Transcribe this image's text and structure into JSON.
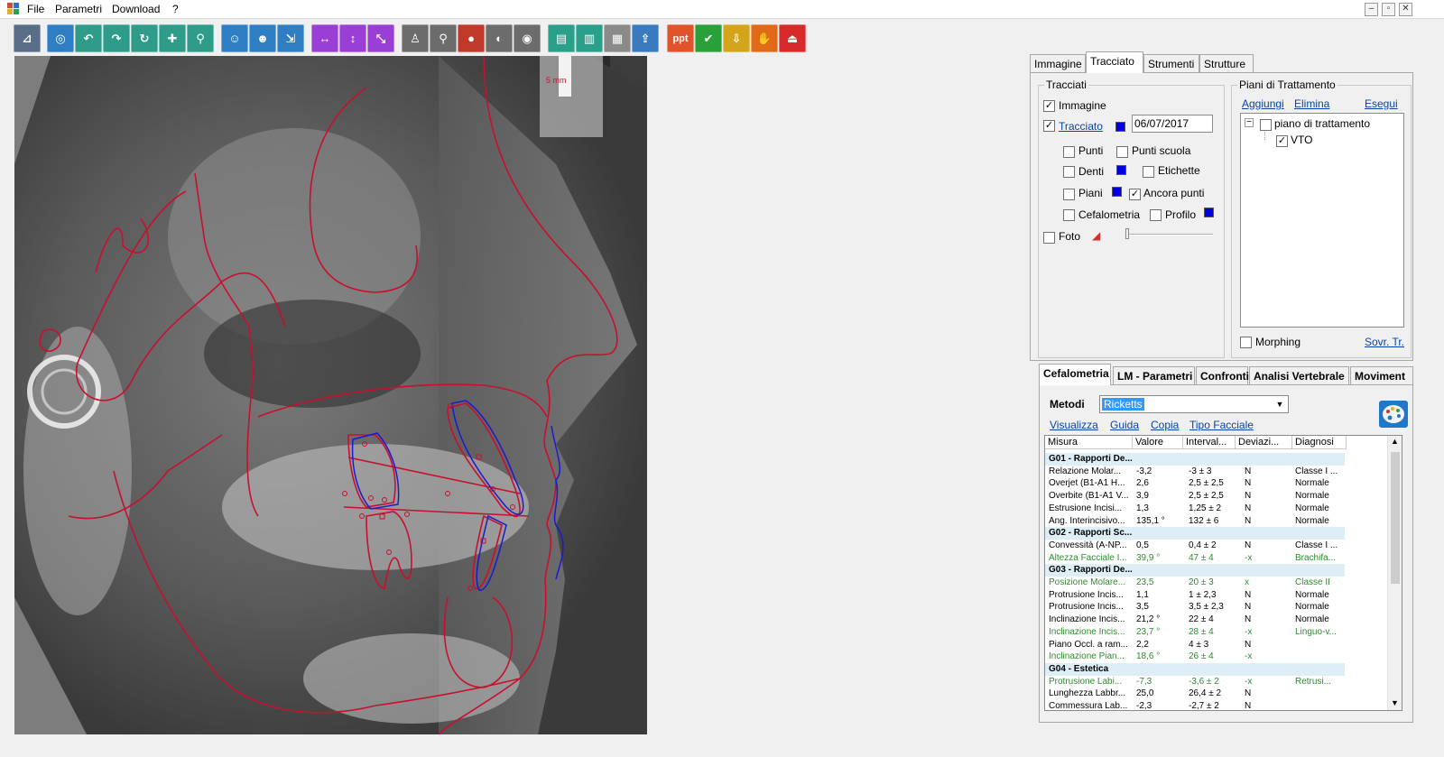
{
  "menu": {
    "items": [
      "File",
      "Parametri",
      "Download",
      "?"
    ]
  },
  "window_controls": [
    "–",
    "▫",
    "✕"
  ],
  "toolbar": {
    "buttons": [
      {
        "name": "measure-tool-icon",
        "color": "#5a6e87"
      },
      {
        "name": "point-zoom-icon",
        "color": "#2f7ec4"
      },
      {
        "name": "undo-icon",
        "color": "#2f9c8a"
      },
      {
        "name": "redo-icon",
        "color": "#2f9c8a"
      },
      {
        "name": "rotate-point-icon",
        "color": "#2f9c8a"
      },
      {
        "name": "point-add-icon",
        "color": "#2f9c8a"
      },
      {
        "name": "point-search-icon",
        "color": "#2f9c8a"
      },
      {
        "name": "patient-photo-icon",
        "color": "#2f7ec4"
      },
      {
        "name": "patient-search-icon",
        "color": "#2f7ec4"
      },
      {
        "name": "profile-import-icon",
        "color": "#2f7ec4"
      },
      {
        "name": "move-horizontal-icon",
        "color": "#9a3fd6"
      },
      {
        "name": "move-vertical-icon",
        "color": "#9a3fd6"
      },
      {
        "name": "move-diagonal-icon",
        "color": "#9a3fd6"
      },
      {
        "name": "person-profile-icon",
        "color": "#6c6c6c"
      },
      {
        "name": "magnifier-icon",
        "color": "#6c6c6c"
      },
      {
        "name": "lips-icon",
        "color": "#c0392b"
      },
      {
        "name": "face-contour-icon",
        "color": "#6c6c6c"
      },
      {
        "name": "eye-icon",
        "color": "#6c6c6c"
      },
      {
        "name": "print-icon",
        "color": "#2aa08a"
      },
      {
        "name": "print-preview-icon",
        "color": "#2aa08a"
      },
      {
        "name": "print-report-icon",
        "color": "#8a8a8a"
      },
      {
        "name": "export-icon",
        "color": "#3a7bbf"
      },
      {
        "name": "powerpoint-icon",
        "color": "#e0532b",
        "text": "ppt"
      },
      {
        "name": "check-icon",
        "color": "#2aa03a"
      },
      {
        "name": "download-icon",
        "color": "#d4a51a"
      },
      {
        "name": "hand-icon",
        "color": "#e06a18"
      },
      {
        "name": "exit-icon",
        "color": "#d82a2a"
      }
    ]
  },
  "xray": {
    "ruler_label": "5 mm"
  },
  "top_tabs": [
    {
      "label": "Immagine",
      "active": false
    },
    {
      "label": "Tracciato",
      "active": true
    },
    {
      "label": "Strumenti",
      "active": false
    },
    {
      "label": "Strutture",
      "active": false
    }
  ],
  "tracciati": {
    "legend": "Tracciati",
    "immagine_label": "Immagine",
    "immagine_checked": true,
    "tracciato_label": "Tracciato",
    "tracciato_checked": true,
    "tracciato_color": "#0000e0",
    "date_value": "06/07/2017",
    "punti_label": "Punti",
    "punti_scuola_label": "Punti scuola",
    "denti_label": "Denti",
    "etichette_label": "Etichette",
    "piani_label": "Piani",
    "ancora_punti_label": "Ancora punti",
    "ancora_punti_checked": true,
    "cefalometria_label": "Cefalometria",
    "profilo_label": "Profilo",
    "foto_label": "Foto"
  },
  "piani": {
    "legend": "Piani di Trattamento",
    "aggiungi": "Aggiungi",
    "elimina": "Elimina",
    "esegui": "Esegui",
    "tree_root": "piano di trattamento",
    "tree_child": "VTO",
    "tree_child_checked": true,
    "morphing_label": "Morphing",
    "sovr_tr": "Sovr. Tr."
  },
  "bottom_tabs": [
    {
      "label": "Cefalometria",
      "active": true
    },
    {
      "label": "LM - Parametri",
      "active": false
    },
    {
      "label": "Confronti",
      "active": false
    },
    {
      "label": "Analisi Vertebrale",
      "active": false
    },
    {
      "label": "Moviment",
      "active": false
    }
  ],
  "cefalometria": {
    "metodi_label": "Metodi",
    "metodi_value": "Ricketts",
    "links": [
      "Visualizza",
      "Guida",
      "Copia",
      "Tipo Facciale"
    ],
    "columns": [
      "Misura",
      "Valore",
      "Interval...",
      "Deviazi...",
      "Diagnosi"
    ],
    "rows": [
      {
        "group": true,
        "misura": "G01 - Rapporti De..."
      },
      {
        "misura": "Relazione Molar...",
        "valore": "-3,2",
        "intervallo": "-3 ± 3",
        "deviazione": "N",
        "diagnosi": "Classe I ...",
        "highlight": false
      },
      {
        "misura": "Overjet (B1-A1 H...",
        "valore": "2,6",
        "intervallo": "2,5 ± 2,5",
        "deviazione": "N",
        "diagnosi": "Normale",
        "highlight": false
      },
      {
        "misura": "Overbite (B1-A1 V...",
        "valore": "3,9",
        "intervallo": "2,5 ± 2,5",
        "deviazione": "N",
        "diagnosi": "Normale",
        "highlight": false
      },
      {
        "misura": "Estrusione Incisi...",
        "valore": "1,3",
        "intervallo": "1,25 ± 2",
        "deviazione": "N",
        "diagnosi": "Normale",
        "highlight": false
      },
      {
        "misura": "Ang. Interincisivo...",
        "valore": "135,1 °",
        "intervallo": "132 ± 6",
        "deviazione": "N",
        "diagnosi": "Normale",
        "highlight": false
      },
      {
        "group": true,
        "misura": "G02 - Rapporti Sc..."
      },
      {
        "misura": "Convessità (A-NP...",
        "valore": "0,5",
        "intervallo": "0,4 ± 2",
        "deviazione": "N",
        "diagnosi": "Classe I ...",
        "highlight": false
      },
      {
        "misura": "Altezza Facciale I...",
        "valore": "39,9 °",
        "intervallo": "47 ± 4",
        "deviazione": "-x",
        "diagnosi": "Brachifa...",
        "highlight": true
      },
      {
        "group": true,
        "misura": "G03 - Rapporti De..."
      },
      {
        "misura": "Posizione Molare...",
        "valore": "23,5",
        "intervallo": "20 ± 3",
        "deviazione": "x",
        "diagnosi": "Classe II",
        "highlight": true
      },
      {
        "misura": "Protrusione Incis...",
        "valore": "1,1",
        "intervallo": "1 ± 2,3",
        "deviazione": "N",
        "diagnosi": "Normale",
        "highlight": false
      },
      {
        "misura": "Protrusione Incis...",
        "valore": "3,5",
        "intervallo": "3,5 ± 2,3",
        "deviazione": "N",
        "diagnosi": "Normale",
        "highlight": false
      },
      {
        "misura": "Inclinazione Incis...",
        "valore": "21,2 °",
        "intervallo": "22 ± 4",
        "deviazione": "N",
        "diagnosi": "Normale",
        "highlight": false
      },
      {
        "misura": "Inclinazione Incis...",
        "valore": "23,7 °",
        "intervallo": "28 ± 4",
        "deviazione": "-x",
        "diagnosi": "Linguo-v...",
        "highlight": true
      },
      {
        "misura": "Piano Occl. a ram...",
        "valore": "2,2",
        "intervallo": "4 ± 3",
        "deviazione": "N",
        "diagnosi": "",
        "highlight": false
      },
      {
        "misura": "Inclinazione Pian...",
        "valore": "18,6 °",
        "intervallo": "26 ± 4",
        "deviazione": "-x",
        "diagnosi": "",
        "highlight": true
      },
      {
        "group": true,
        "misura": "G04 - Estetica"
      },
      {
        "misura": "Protrusione Labi...",
        "valore": "-7,3",
        "intervallo": "-3,6 ± 2",
        "deviazione": "-x",
        "diagnosi": "Retrusi...",
        "highlight": true
      },
      {
        "misura": "Lunghezza Labbr...",
        "valore": "25,0",
        "intervallo": "26,4 ± 2",
        "deviazione": "N",
        "diagnosi": "",
        "highlight": false
      },
      {
        "misura": "Commessura Lab...",
        "valore": "-2,3",
        "intervallo": "-2,7 ± 2",
        "deviazione": "N",
        "diagnosi": "",
        "highlight": false
      }
    ]
  },
  "colors": {
    "highlight_text": "#2e8b2e",
    "trace_red": "#c8102e",
    "trace_blue": "#1a1ad0",
    "link": "#0645ad"
  }
}
